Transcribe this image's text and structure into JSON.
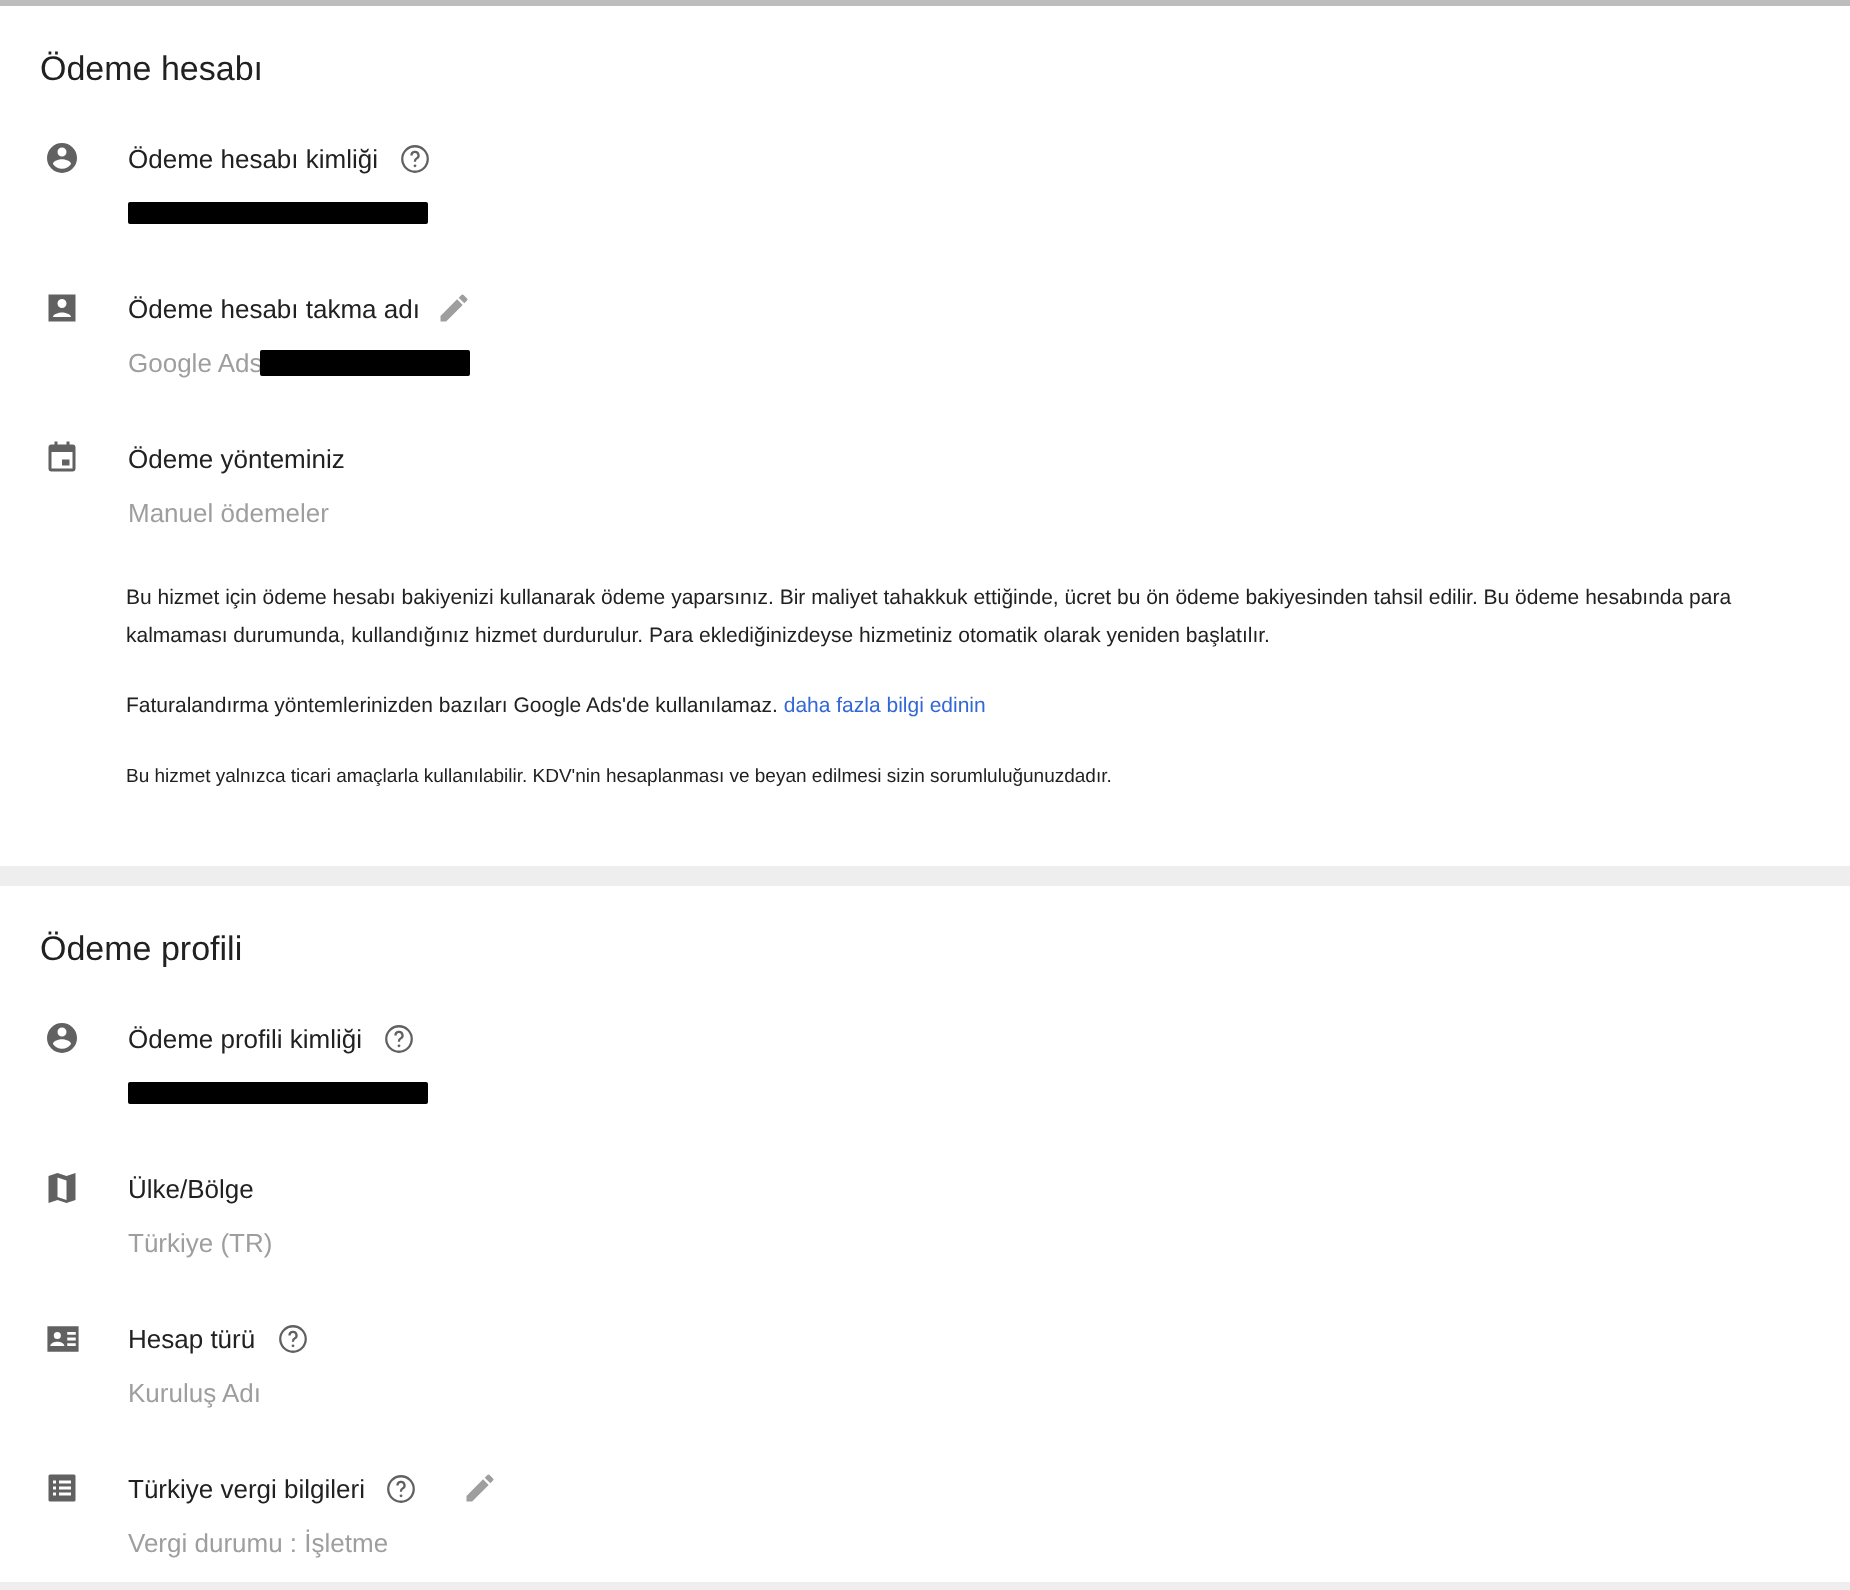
{
  "sections": [
    {
      "title": "Ödeme hesabı",
      "fields": [
        {
          "kind": "account",
          "label": "Ödeme hesabı kimliği",
          "help": true,
          "editable": false,
          "redacted": true
        },
        {
          "kind": "contact",
          "label": "Ödeme hesabı takma adı",
          "help": false,
          "editable": true,
          "value": "Google Ads",
          "redacted": true
        },
        {
          "kind": "calendar",
          "label": "Ödeme yönteminiz",
          "help": false,
          "editable": false,
          "value": "Manuel ödemeler",
          "redacted": false
        }
      ],
      "notes": [
        {
          "text": "Bu hizmet için ödeme hesabı bakiyenizi kullanarak ödeme yaparsınız. Bir maliyet tahakkuk ettiğinde, ücret bu ön ödeme bakiyesinden tahsil edilir. Bu ödeme hesabında para kalmaması durumunda, kullandığınız hizmet durdurulur. Para eklediğinizdeyse hizmetiniz otomatik olarak yeniden başlatılır.",
          "small": false
        },
        {
          "text": "Faturalandırma yöntemlerinizden bazıları Google Ads'de kullanılamaz.",
          "link": "daha fazla bilgi edinin",
          "small": false
        },
        {
          "text": "Bu hizmet yalnızca ticari amaçlarla kullanılabilir. KDV'nin hesaplanması ve beyan edilmesi sizin sorumluluğunuzdadır.",
          "small": true
        }
      ]
    },
    {
      "title": "Ödeme profili",
      "fields": [
        {
          "kind": "account",
          "label": "Ödeme profili kimliği",
          "help": true,
          "editable": false,
          "redacted": true
        },
        {
          "kind": "map",
          "label": "Ülke/Bölge",
          "help": false,
          "editable": false,
          "value": "Türkiye (TR)",
          "redacted": false
        },
        {
          "kind": "id-card",
          "label": "Hesap türü",
          "help": true,
          "editable": false,
          "value": "Kuruluş Adı",
          "redacted": false
        },
        {
          "kind": "list",
          "label": "Türkiye vergi bilgileri",
          "help": true,
          "editable": true,
          "value": "Vergi durumu : İşletme",
          "redacted": false
        }
      ]
    }
  ]
}
